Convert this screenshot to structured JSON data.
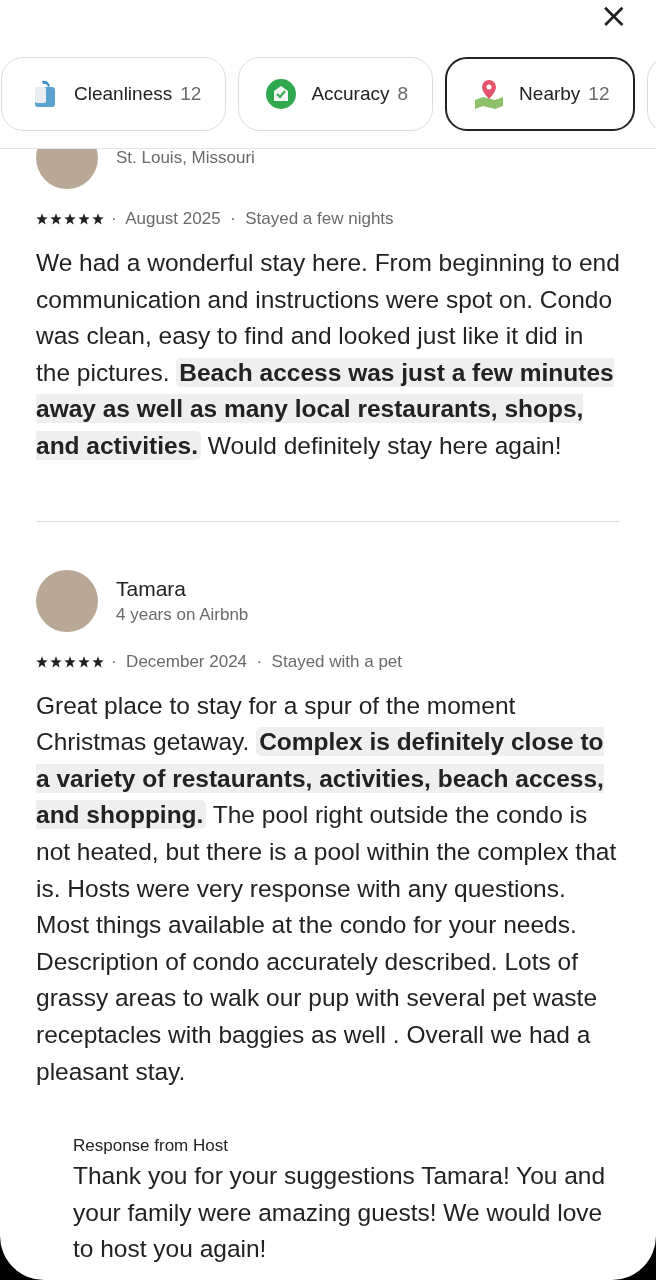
{
  "close_button": "×",
  "chips": [
    {
      "kind": "cleanliness",
      "label": "Cleanliness",
      "count": "12",
      "selected": false
    },
    {
      "kind": "accuracy",
      "label": "Accuracy",
      "count": "8",
      "selected": false
    },
    {
      "kind": "nearby",
      "label": "Nearby",
      "count": "12",
      "selected": true
    }
  ],
  "reviews": [
    {
      "subtitle": "St. Louis, Missouri",
      "stars": 5,
      "meta": "·  August 2025  ·  Stayed a few nights",
      "text": "We had a wonderful stay here.  From beginning to end communication and instructions were spot on. Condo was clean, easy to find and looked just like it did in the pictures.  **Beach access was just a few minutes away as well as many local restaurants, shops, and activities.**  Would definitely stay here again!"
    },
    {
      "name": "Tamara",
      "subtitle": "4 years on Airbnb",
      "stars": 5,
      "meta": "·  December 2024  ·  Stayed with a pet",
      "text": "Great place to stay for a spur of the moment Christmas getaway. **Complex is definitely close to a variety of restaurants, activities, beach access, and shopping.** The pool right outside the condo is not heated, but there is a pool within the complex that is. Hosts were very response with any questions. Most things available at the condo for your needs. Description of condo accurately described. Lots of grassy areas to walk our pup with several pet waste receptacles with baggies as well . Overall we had a pleasant stay.",
      "host_response": {
        "label": "Response from Host",
        "text": "Thank you for your suggestions Tamara! You and your family were amazing guests! We would love to host you again!"
      }
    }
  ]
}
